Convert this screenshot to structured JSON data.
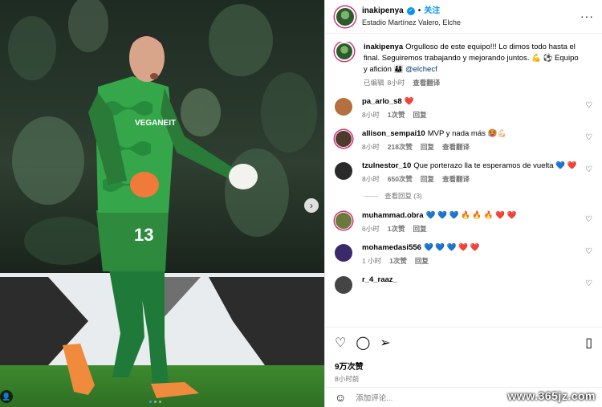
{
  "header": {
    "username": "inakipenya",
    "follow_label": "关注",
    "location": "Estadio Martínez Valero, Elche",
    "more_label": "···"
  },
  "photo": {
    "jersey_number": "13",
    "sponsor": "VEGANEIT",
    "next_label": "›",
    "carousel_count": 3,
    "carousel_active": 0
  },
  "caption": {
    "username": "inakipenya",
    "text": "Orgulloso de este equipo!!! Lo dimos todo hasta el final. Seguiremos trabajando y mejorando juntos. 💪 ⚽ Equipo y afición 👨‍👩‍👦",
    "mention": "@elchecf",
    "edited": "已编辑",
    "time": "8小时",
    "translate": "查看翻译"
  },
  "comments": [
    {
      "user": "pa_arlo_s8",
      "text": "❤️",
      "time": "8小时",
      "likes": "1次赞",
      "reply": "回复",
      "translate": "",
      "avatar_color": "#b5703f"
    },
    {
      "user": "allison_sempai10",
      "text": "MVP y nada más 🥵💪🏻",
      "time": "8小时",
      "likes": "218次赞",
      "reply": "回复",
      "translate": "查看翻译",
      "avatar_color": "#4f3a2e"
    },
    {
      "user": "tzulnestor_10",
      "text": "Que porterazo lla te esperamos de vuelta 💙 ❤️",
      "time": "8小时",
      "likes": "650次赞",
      "reply": "回复",
      "translate": "查看翻译",
      "avatar_color": "#2a2a2a"
    },
    {
      "user": "muhammad.obra",
      "text": "💙 💙 💙 🔥 🔥 🔥 ❤️ ❤️",
      "time": "6小时",
      "likes": "1次赞",
      "reply": "回复",
      "translate": "",
      "avatar_color": "#6a7a3a"
    },
    {
      "user": "mohamedasi556",
      "text": "💙 💙 💙 ❤️ ❤️",
      "time": "1 小时",
      "likes": "1次赞",
      "reply": "回复",
      "translate": "",
      "avatar_color": "#3a2a6a"
    },
    {
      "user": "r_4_raaz_",
      "text": "",
      "time": "",
      "likes": "",
      "reply": "",
      "translate": "",
      "avatar_color": "#444"
    }
  ],
  "view_replies": "查看回复 (3)",
  "footer": {
    "likes": "9万次赞",
    "time": "8小时前",
    "add_comment_placeholder": "添加评论..."
  },
  "watermark": "www.365jz.com",
  "colors": {
    "accent": "#0095f6",
    "mention": "#00376b",
    "muted": "#737373"
  }
}
